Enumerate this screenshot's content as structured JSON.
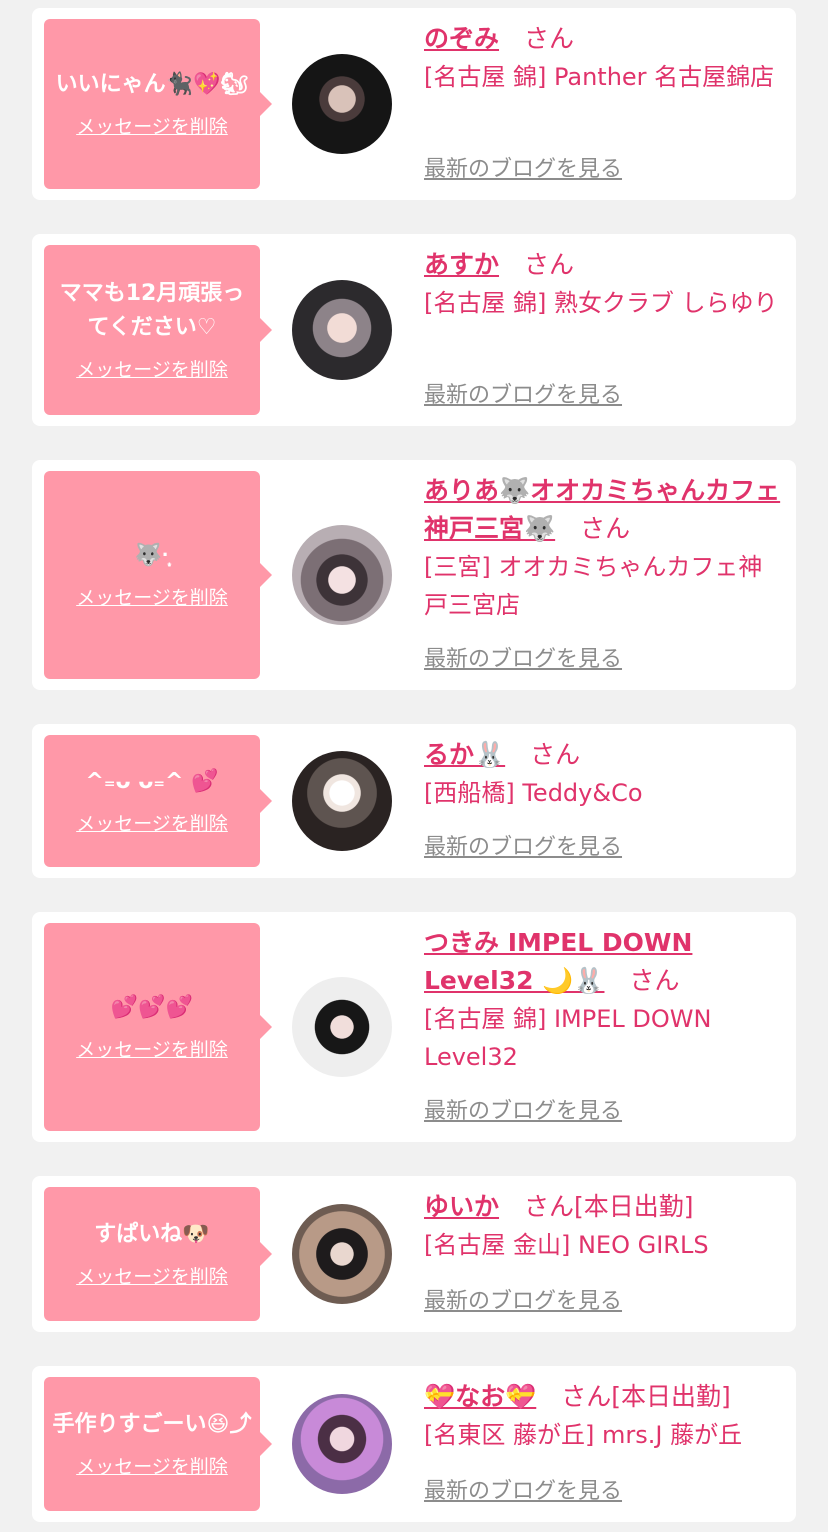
{
  "san_label": "さん",
  "delete_label": "メッセージを削除",
  "blog_label": "最新のブログを見る",
  "entries": [
    {
      "message": "いいにゃん🐈‍⬛💖🐿",
      "name": "のぞみ",
      "status": "",
      "shop": "[名古屋 錦] Panther 名古屋錦店"
    },
    {
      "message": "ママも12月頑張ってください♡",
      "name": "あすか",
      "status": "",
      "shop": "[名古屋 錦] 熟女クラブ しらゆり"
    },
    {
      "message": "🐺·̩͙",
      "name": "ありあ🐺オオカミちゃんカフェ神戸三宮🐺",
      "status": "",
      "shop": "[三宮] オオカミちゃんカフェ神戸三宮店"
    },
    {
      "message": "^₌ᴗ ᴗ₌^ 💕",
      "name": "るか🐰",
      "status": "",
      "shop": "[西船橋] Teddy&Co"
    },
    {
      "message": "💕💕💕",
      "name": "つきみ IMPEL DOWN Level32 🌙🐰",
      "status": "",
      "shop": "[名古屋 錦] IMPEL DOWN Level32"
    },
    {
      "message": "すぱいね🐶",
      "name": "ゆいか",
      "status": "[本日出勤]",
      "shop": "[名古屋 金山] NEO GIRLS"
    },
    {
      "message": "手作りすごーい😆⤴",
      "name": "💝なお💝",
      "status": "[本日出勤]",
      "shop": "[名東区 藤が丘] mrs.J 藤が丘"
    }
  ]
}
